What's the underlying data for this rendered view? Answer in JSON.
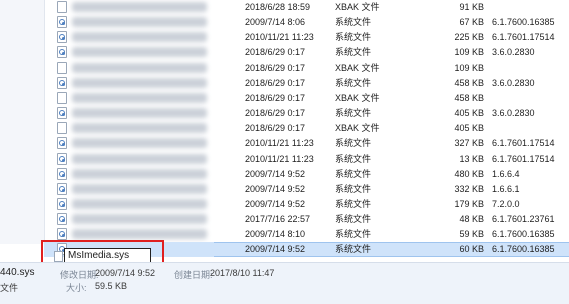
{
  "files": [
    {
      "date": "2018/6/28 18:59",
      "type": "XBAK 文件",
      "size": "91 KB",
      "version": "",
      "icon": "blank-file-icon"
    },
    {
      "date": "2009/7/14 8:06",
      "type": "系统文件",
      "size": "67 KB",
      "version": "6.1.7600.16385",
      "icon": "sys-file-icon"
    },
    {
      "date": "2010/11/21 11:23",
      "type": "系统文件",
      "size": "225 KB",
      "version": "6.1.7601.17514",
      "icon": "sys-file-icon"
    },
    {
      "date": "2018/6/29 0:17",
      "type": "系统文件",
      "size": "109 KB",
      "version": "3.6.0.2830",
      "icon": "sys-file-icon"
    },
    {
      "date": "2018/6/29 0:17",
      "type": "XBAK 文件",
      "size": "109 KB",
      "version": "",
      "icon": "blank-file-icon"
    },
    {
      "date": "2018/6/29 0:17",
      "type": "系统文件",
      "size": "458 KB",
      "version": "3.6.0.2830",
      "icon": "sys-file-icon"
    },
    {
      "date": "2018/6/29 0:17",
      "type": "XBAK 文件",
      "size": "458 KB",
      "version": "",
      "icon": "blank-file-icon"
    },
    {
      "date": "2018/6/29 0:17",
      "type": "系统文件",
      "size": "405 KB",
      "version": "3.6.0.2830",
      "icon": "sys-file-icon"
    },
    {
      "date": "2018/6/29 0:17",
      "type": "XBAK 文件",
      "size": "405 KB",
      "version": "",
      "icon": "blank-file-icon"
    },
    {
      "date": "2010/11/21 11:23",
      "type": "系统文件",
      "size": "327 KB",
      "version": "6.1.7601.17514",
      "icon": "sys-file-icon"
    },
    {
      "date": "2010/11/21 11:23",
      "type": "系统文件",
      "size": "13 KB",
      "version": "6.1.7601.17514",
      "icon": "sys-file-icon"
    },
    {
      "date": "2009/7/14 9:52",
      "type": "系统文件",
      "size": "480 KB",
      "version": "1.6.6.4",
      "icon": "sys-file-icon"
    },
    {
      "date": "2009/7/14 9:52",
      "type": "系统文件",
      "size": "332 KB",
      "version": "1.6.6.1",
      "icon": "sys-file-icon"
    },
    {
      "date": "2009/7/14 9:52",
      "type": "系统文件",
      "size": "179 KB",
      "version": "7.2.0.0",
      "icon": "sys-file-icon"
    },
    {
      "date": "2017/7/16 22:57",
      "type": "系统文件",
      "size": "48 KB",
      "version": "6.1.7601.23761",
      "icon": "sys-file-icon"
    },
    {
      "date": "2009/7/14 8:10",
      "type": "系统文件",
      "size": "59 KB",
      "version": "6.1.7600.16385",
      "icon": "sys-file-icon"
    },
    {
      "date": "2009/7/14 9:52",
      "type": "系统文件",
      "size": "60 KB",
      "version": "6.1.7600.16385",
      "icon": "sys-file-icon",
      "selected": true
    }
  ],
  "rename": {
    "value": "MsImedia.sys"
  },
  "details": {
    "filename_partial": "440.sys",
    "modified_label": "修改日期:",
    "modified_value": "2009/7/14 9:52",
    "created_label": "创建日期:",
    "created_value": "2017/8/10 11:47",
    "type_partial": "文件",
    "size_label": "大小:",
    "size_value": "59.5 KB"
  },
  "colors": {
    "highlight": "#e02020",
    "selection": "#cfe3fa"
  }
}
